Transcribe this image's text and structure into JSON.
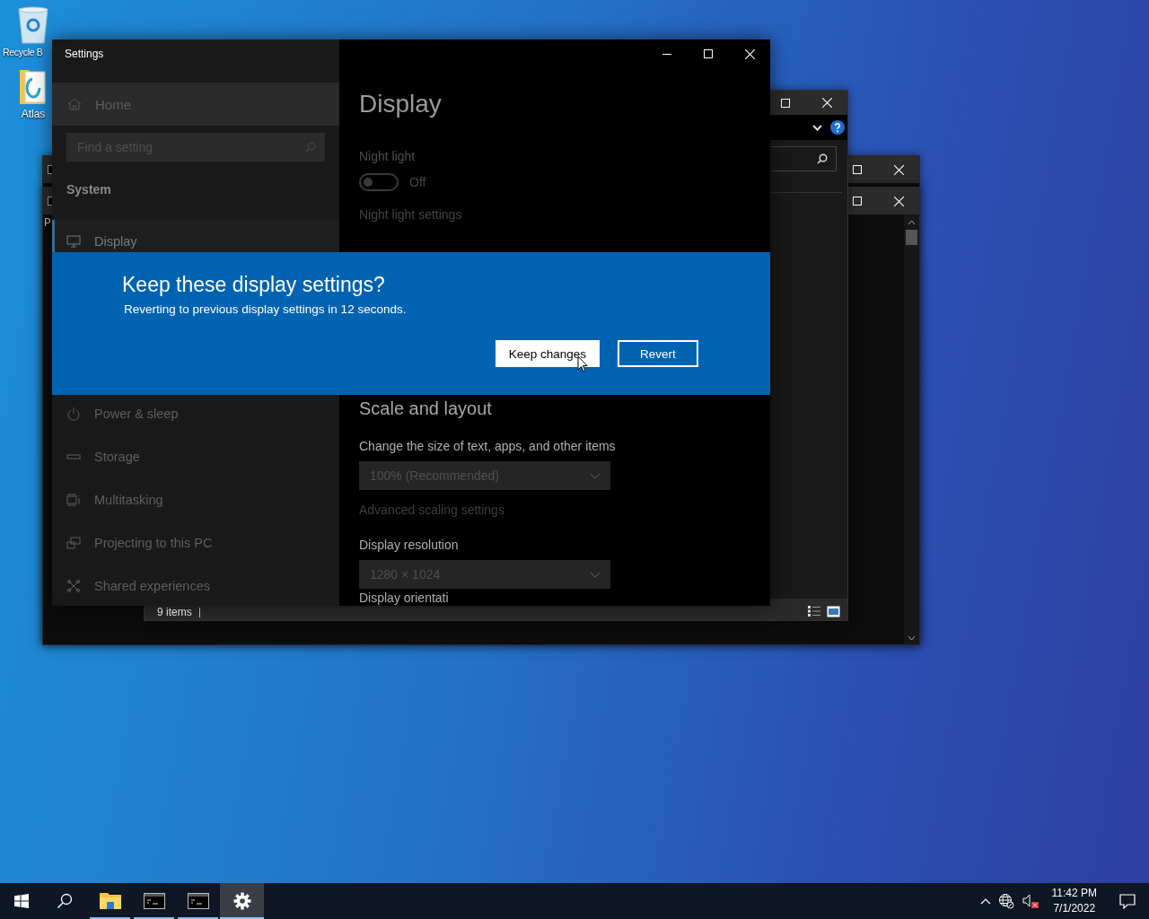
{
  "desktop_icons": [
    {
      "kind": "bin",
      "label": "Recycle B"
    },
    {
      "kind": "folder",
      "label": "Atlas"
    }
  ],
  "background_windows": [
    {
      "kind": "console"
    },
    {
      "kind": "console",
      "text": "P"
    },
    {
      "kind": "explorer",
      "status": "9 items"
    }
  ],
  "settings_window": {
    "title": "Settings",
    "sidebar": {
      "home": "Home",
      "search": {
        "placeholder": "Find a setting"
      },
      "section": "System",
      "items": [
        {
          "kind": "display",
          "label": "Display",
          "selected": true
        },
        {
          "kind": "power",
          "label": "Power & sleep",
          "selected": false
        },
        {
          "kind": "storage",
          "label": "Storage",
          "selected": false
        },
        {
          "kind": "multitasking",
          "label": "Multitasking",
          "selected": false
        },
        {
          "kind": "projecting",
          "label": "Projecting to this PC",
          "selected": false
        },
        {
          "kind": "shared",
          "label": "Shared experiences",
          "selected": false
        }
      ]
    },
    "content": {
      "title": "Display",
      "night_light": {
        "label": "Night light",
        "on": false,
        "state": "Off",
        "link": "Night light settings"
      },
      "scale_heading": "Scale and layout",
      "scale_label": "Change the size of text, apps, and other items",
      "scale_value": "100% (Recommended)",
      "scale_link": "Advanced scaling settings",
      "resolution_label": "Display resolution",
      "resolution_value": "1280 × 1024",
      "orientation_label": "Display orientati"
    }
  },
  "dialog": {
    "title": "Keep these display settings?",
    "message": "Reverting to previous display settings in 12 seconds.",
    "buttons": [
      {
        "label": "Keep changes",
        "primary": true
      },
      {
        "label": "Revert",
        "primary": false
      }
    ]
  },
  "taskbar": {
    "apps": [
      {
        "kind": "explorer",
        "running": true,
        "active": false
      },
      {
        "kind": "console",
        "running": true,
        "active": false
      },
      {
        "kind": "console",
        "running": true,
        "active": false
      },
      {
        "kind": "settings",
        "running": true,
        "active": true
      }
    ],
    "clock": {
      "time": "11:42 PM",
      "date": "7/1/2022"
    }
  }
}
